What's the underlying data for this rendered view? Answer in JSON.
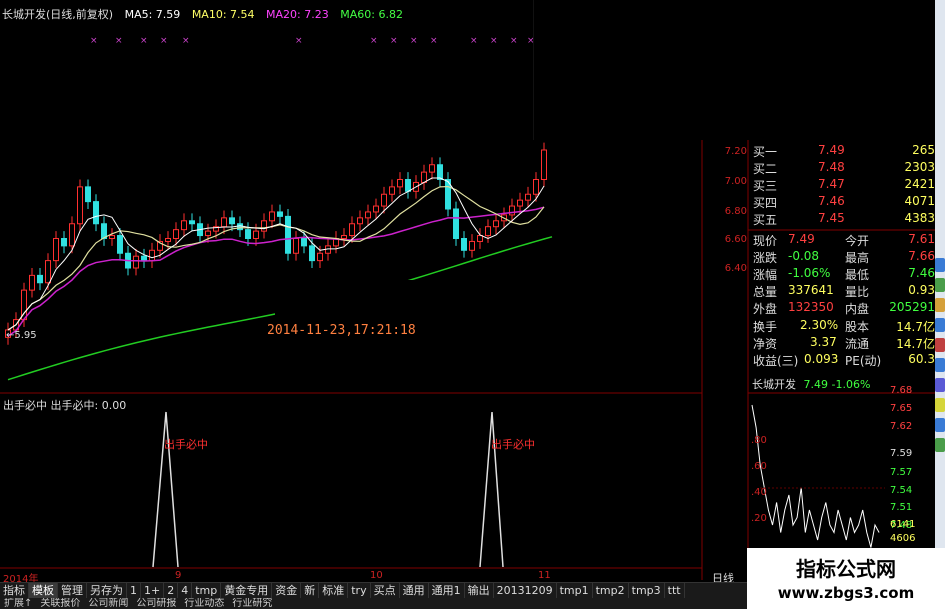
{
  "header": {
    "title": "长城开发(日线,前复权)",
    "ma5": "MA5: 7.59",
    "ma10": "MA10: 7.54",
    "ma20": "MA20: 7.23",
    "ma60": "MA60: 6.82",
    "colors": {
      "ma5": "#ffffff",
      "ma10": "#ffff00",
      "ma20": "#ff00ff",
      "ma60": "#00ff00"
    }
  },
  "main_chart": {
    "low_marker": "5.95",
    "timestamp": "2014-11-23,17:21:18",
    "price_axis": [
      "7.20",
      "7.00",
      "6.80",
      "6.60",
      "6.40"
    ]
  },
  "indicator": {
    "label": "出手必中  出手必中: 0.00",
    "signal_text_1": "出手必中",
    "signal_text_2": "出手必中"
  },
  "x_axis": {
    "year": "2014年",
    "m9": "9",
    "m10": "10",
    "m11": "11"
  },
  "quote_panel": {
    "bids": [
      {
        "label": "买一",
        "price": "7.49",
        "vol": "265"
      },
      {
        "label": "买二",
        "price": "7.48",
        "vol": "2303"
      },
      {
        "label": "买三",
        "price": "7.47",
        "vol": "2421"
      },
      {
        "label": "买四",
        "price": "7.46",
        "vol": "4071"
      },
      {
        "label": "买五",
        "price": "7.45",
        "vol": "4383"
      }
    ],
    "stats": [
      {
        "l1": "现价",
        "v1": "7.49",
        "l2": "今开",
        "v2": "7.61"
      },
      {
        "l1": "涨跌",
        "v1": "-0.08",
        "l2": "最高",
        "v2": "7.66"
      },
      {
        "l1": "涨幅",
        "v1": "-1.06%",
        "l2": "最低",
        "v2": "7.46"
      },
      {
        "l1": "总量",
        "v1": "337641",
        "l2": "量比",
        "v2": "0.93"
      },
      {
        "l1": "外盘",
        "v1": "132350",
        "l2": "内盘",
        "v2": "205291"
      },
      {
        "l1": "换手",
        "v1": "2.30%",
        "l2": "股本",
        "v2": "14.7亿"
      },
      {
        "l1": "净资",
        "v1": "3.37",
        "l2": "流通",
        "v2": "14.7亿"
      },
      {
        "l1": "收益(三)",
        "v1": "0.093",
        "l2": "PE(动)",
        "v2": "60.3"
      }
    ],
    "mini_title": "长城开发",
    "mini_quote": "7.49  -1.06%",
    "mini_right_axis": [
      "7.68",
      "7.65",
      "7.62",
      "7.59",
      "7.57",
      "7.54",
      "7.51",
      "7.48"
    ],
    "mini_left_axis": [
      ".80",
      ".60",
      ".40",
      ".20"
    ],
    "mini_vol": [
      "6141",
      "4606"
    ]
  },
  "tabs": [
    "指标",
    "模板",
    "管理",
    "另存为",
    "1",
    "1+",
    "2",
    "4",
    "tmp",
    "黄金专用",
    "资金",
    "新",
    "标准",
    "try",
    "买点",
    "通用",
    "通用1",
    "输出",
    "20131209",
    "tmp1",
    "tmp2",
    "tmp3",
    "ttt"
  ],
  "period_label": "日线",
  "bottom_links": [
    "扩展↑",
    "关联报价",
    "公司新闻",
    "公司研报",
    "行业动态",
    "行业研究"
  ],
  "watermark": {
    "line1": "指标公式网",
    "line2": "www.zbgs3.com"
  }
}
